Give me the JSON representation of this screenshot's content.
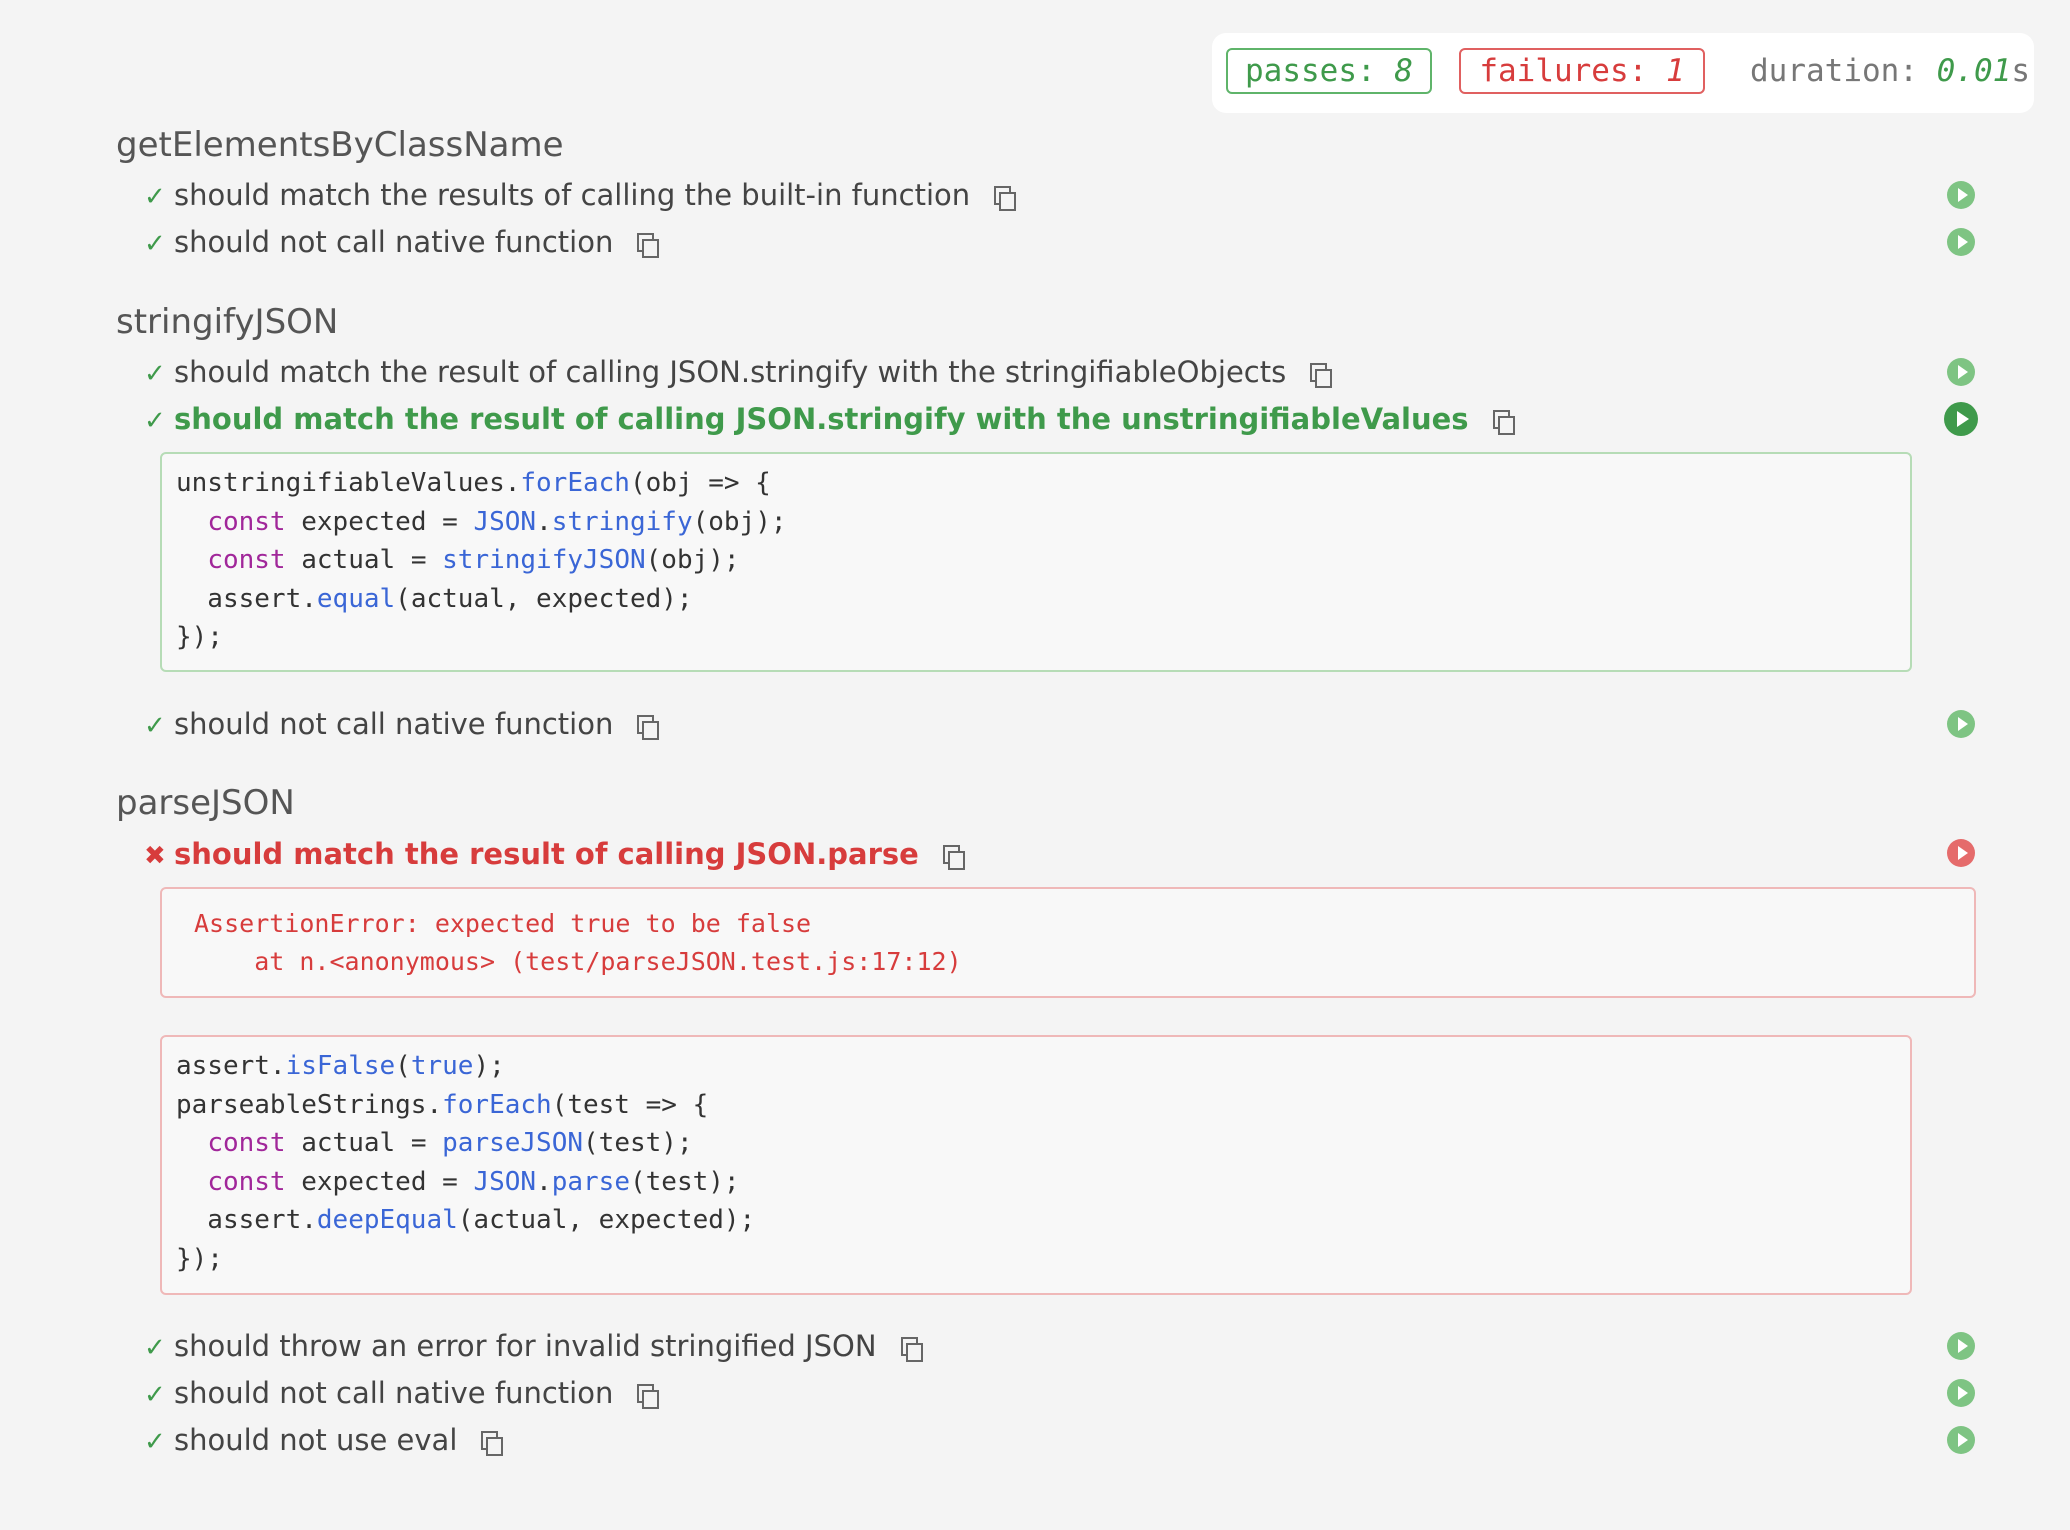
{
  "stats": {
    "passes_label": "passes:",
    "passes_value": "8",
    "failures_label": "failures:",
    "failures_value": "1",
    "duration_label": "duration:",
    "duration_value": "0.01",
    "duration_unit": "s"
  },
  "suites": [
    {
      "title": "getElementsByClassName",
      "tests": [
        {
          "mark": "✓",
          "title": "should match the results of calling the built-in function",
          "state": "pass"
        },
        {
          "mark": "✓",
          "title": "should not call native function",
          "state": "pass"
        }
      ]
    },
    {
      "title": "stringifyJSON",
      "tests": [
        {
          "mark": "✓",
          "title": "should match the result of calling JSON.stringify with the stringifiableObjects",
          "state": "pass"
        },
        {
          "mark": "✓",
          "title": "should match the result of calling JSON.stringify with the unstringifiableValues",
          "state": "pass-expanded"
        },
        {
          "mark": "✓",
          "title": "should not call native function",
          "state": "pass"
        }
      ]
    },
    {
      "title": "parseJSON",
      "tests": [
        {
          "mark": "✖",
          "title": "should match the result of calling JSON.parse",
          "state": "fail-expanded"
        },
        {
          "mark": "✓",
          "title": "should throw an error for invalid stringified JSON",
          "state": "pass"
        },
        {
          "mark": "✓",
          "title": "should not call native function",
          "state": "pass"
        },
        {
          "mark": "✓",
          "title": "should not use eval",
          "state": "pass"
        }
      ]
    }
  ],
  "code_stringify": {
    "l1a": "unstringifiableValues.",
    "l1b": "forEach",
    "l1c": "(obj => {",
    "l2a": "  ",
    "l2k": "const",
    "l2b": " expected = ",
    "l2f1": "JSON",
    "l2c": ".",
    "l2f2": "stringify",
    "l2d": "(obj);",
    "l3a": "  ",
    "l3k": "const",
    "l3b": " actual = ",
    "l3f": "stringifyJSON",
    "l3d": "(obj);",
    "l4a": "  assert.",
    "l4f": "equal",
    "l4d": "(actual, expected);",
    "l5": "});"
  },
  "error": {
    "line1": "AssertionError: expected true to be false",
    "line2": "    at n.<anonymous> (test/parseJSON.test.js:17:12)"
  },
  "code_parse": {
    "l1a": "assert.",
    "l1f": "isFalse",
    "l1b": "(",
    "l1t": "true",
    "l1c": ");",
    "l2a": "parseableStrings.",
    "l2f": "forEach",
    "l2b": "(test => {",
    "l3a": "  ",
    "l3k": "const",
    "l3b": " actual = ",
    "l3f": "parseJSON",
    "l3d": "(test);",
    "l4a": "  ",
    "l4k": "const",
    "l4b": " expected = ",
    "l4f1": "JSON",
    "l4c": ".",
    "l4f2": "parse",
    "l4d": "(test);",
    "l5a": "  assert.",
    "l5f": "deepEqual",
    "l5d": "(actual, expected);",
    "l6": "});"
  }
}
